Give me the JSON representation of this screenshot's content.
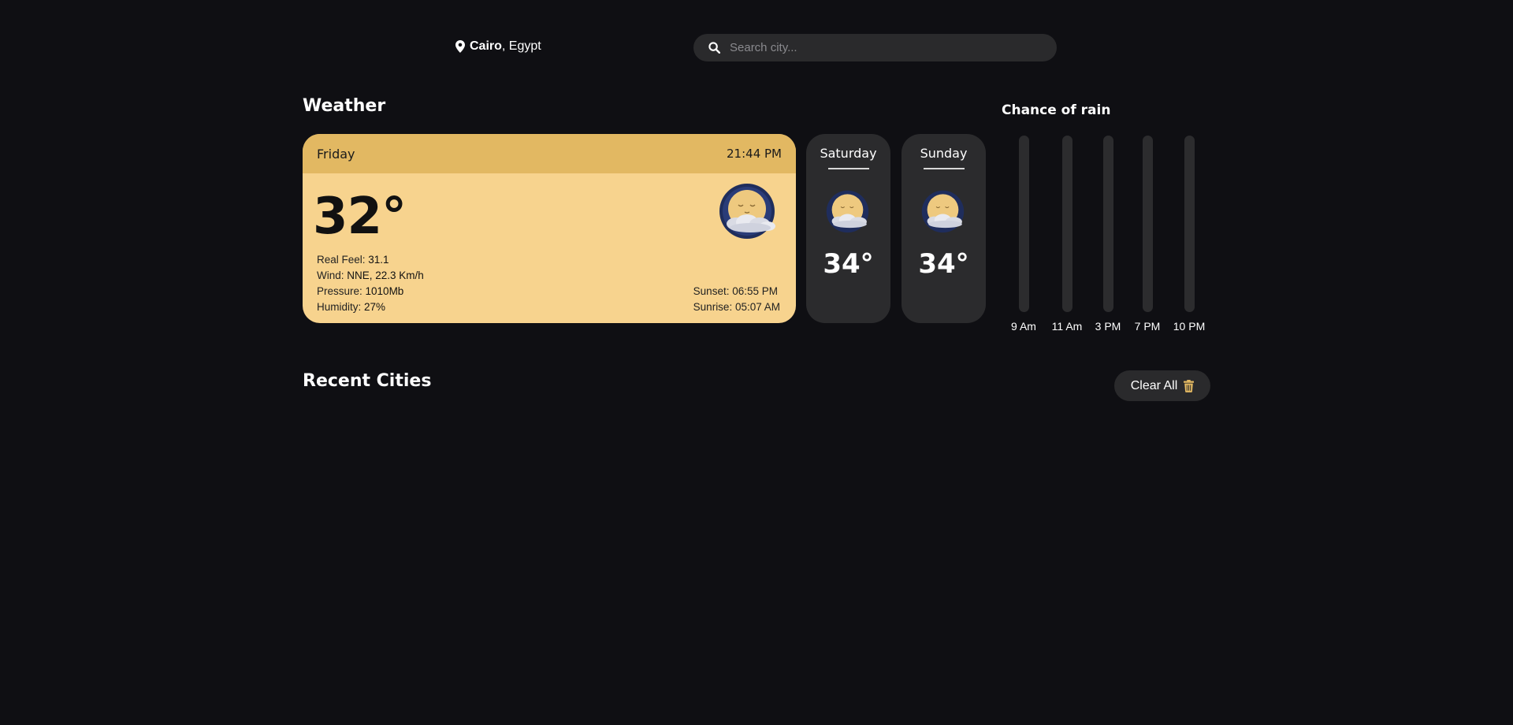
{
  "location": {
    "city": "Cairo",
    "country": ", Egypt",
    "icon": "map-pin-icon"
  },
  "search": {
    "placeholder": "Search city...",
    "value": "",
    "icon": "search-icon"
  },
  "weather_section": {
    "title": "Weather"
  },
  "today": {
    "day": "Friday",
    "time": "21:44 PM",
    "temperature": "32°",
    "icon": "moon-cloud-icon",
    "details": [
      {
        "label": "Real Feel: ",
        "value": "31.1"
      },
      {
        "label": "Wind: ",
        "value": "NNE, 22.3 Km/h"
      },
      {
        "label": "Pressure: ",
        "value": "1010Mb"
      },
      {
        "label": "Humidity: ",
        "value": "27%"
      }
    ],
    "sunset": {
      "label": "Sunset: ",
      "value": "06:55 PM"
    },
    "sunrise": {
      "label": "Sunrise: ",
      "value": "05:07 AM"
    }
  },
  "forecast": [
    {
      "day": "Saturday",
      "temperature": "34°",
      "icon": "moon-cloud-icon"
    },
    {
      "day": "Sunday",
      "temperature": "34°",
      "icon": "moon-cloud-icon"
    }
  ],
  "chance_of_rain": {
    "title": "Chance of rain",
    "hours": [
      {
        "label": "9 Am",
        "percent": 0
      },
      {
        "label": "11 Am",
        "percent": 0
      },
      {
        "label": "3 PM",
        "percent": 0
      },
      {
        "label": "7 PM",
        "percent": 0
      },
      {
        "label": "10 PM",
        "percent": 0
      }
    ]
  },
  "recent": {
    "title": "Recent Cities",
    "clear_label": "Clear All",
    "clear_icon": "trash-icon"
  },
  "colors": {
    "background": "#0f0f13",
    "accent": "#e2b862",
    "card_light": "#f7d38e",
    "card_dark": "#2b2b2d"
  }
}
